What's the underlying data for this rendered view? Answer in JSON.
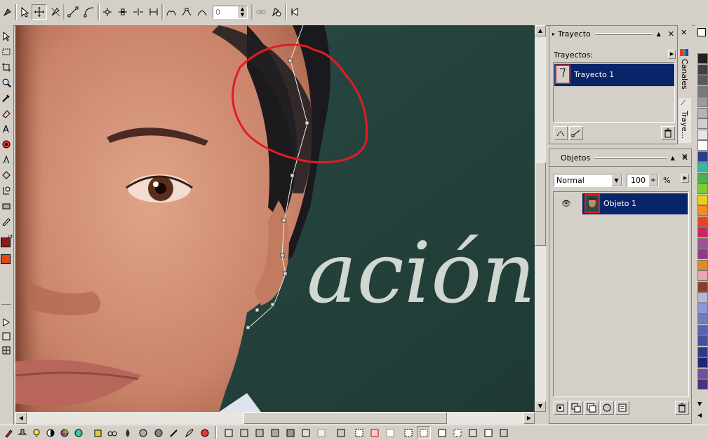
{
  "toolbar": {
    "spin_value": "0"
  },
  "paths_panel": {
    "title": "Trayecto",
    "list_label": "Trayectos:",
    "items": [
      {
        "label": "Trayecto 1"
      }
    ]
  },
  "objects_panel": {
    "title": "Objetos",
    "blend_mode": "Normal",
    "opacity": "100",
    "opacity_unit": "%",
    "items": [
      {
        "label": "Objeto 1"
      }
    ]
  },
  "side_tabs": {
    "channels": "Canales",
    "paths": "Traye..."
  },
  "canvas": {
    "chalk_text": "ación"
  },
  "colors": {
    "primary": "#8b1a1a",
    "secondary": "#e8440f",
    "selection": "#0a246a",
    "annotation": "#e41b23",
    "palette": [
      "#202020",
      "#404040",
      "#5a5a5a",
      "#7a7a7a",
      "#9a9a9a",
      "#b4b4b4",
      "#cfcfcf",
      "#e6e6e6",
      "#ffffff",
      "#2e3c8e",
      "#37b7a7",
      "#4caf50",
      "#80cc33",
      "#e8d21d",
      "#f28c28",
      "#e8441f",
      "#c8285a",
      "#a04d9a",
      "#8a3b8a",
      "#e58a23",
      "#e8a8b8",
      "#8a3d2a",
      "#b0b8dc",
      "#8a9ad0",
      "#6f7cc2",
      "#5864b0",
      "#414f9e",
      "#2e3a86",
      "#1e2770",
      "#6b4fa0",
      "#4d2f80"
    ]
  }
}
